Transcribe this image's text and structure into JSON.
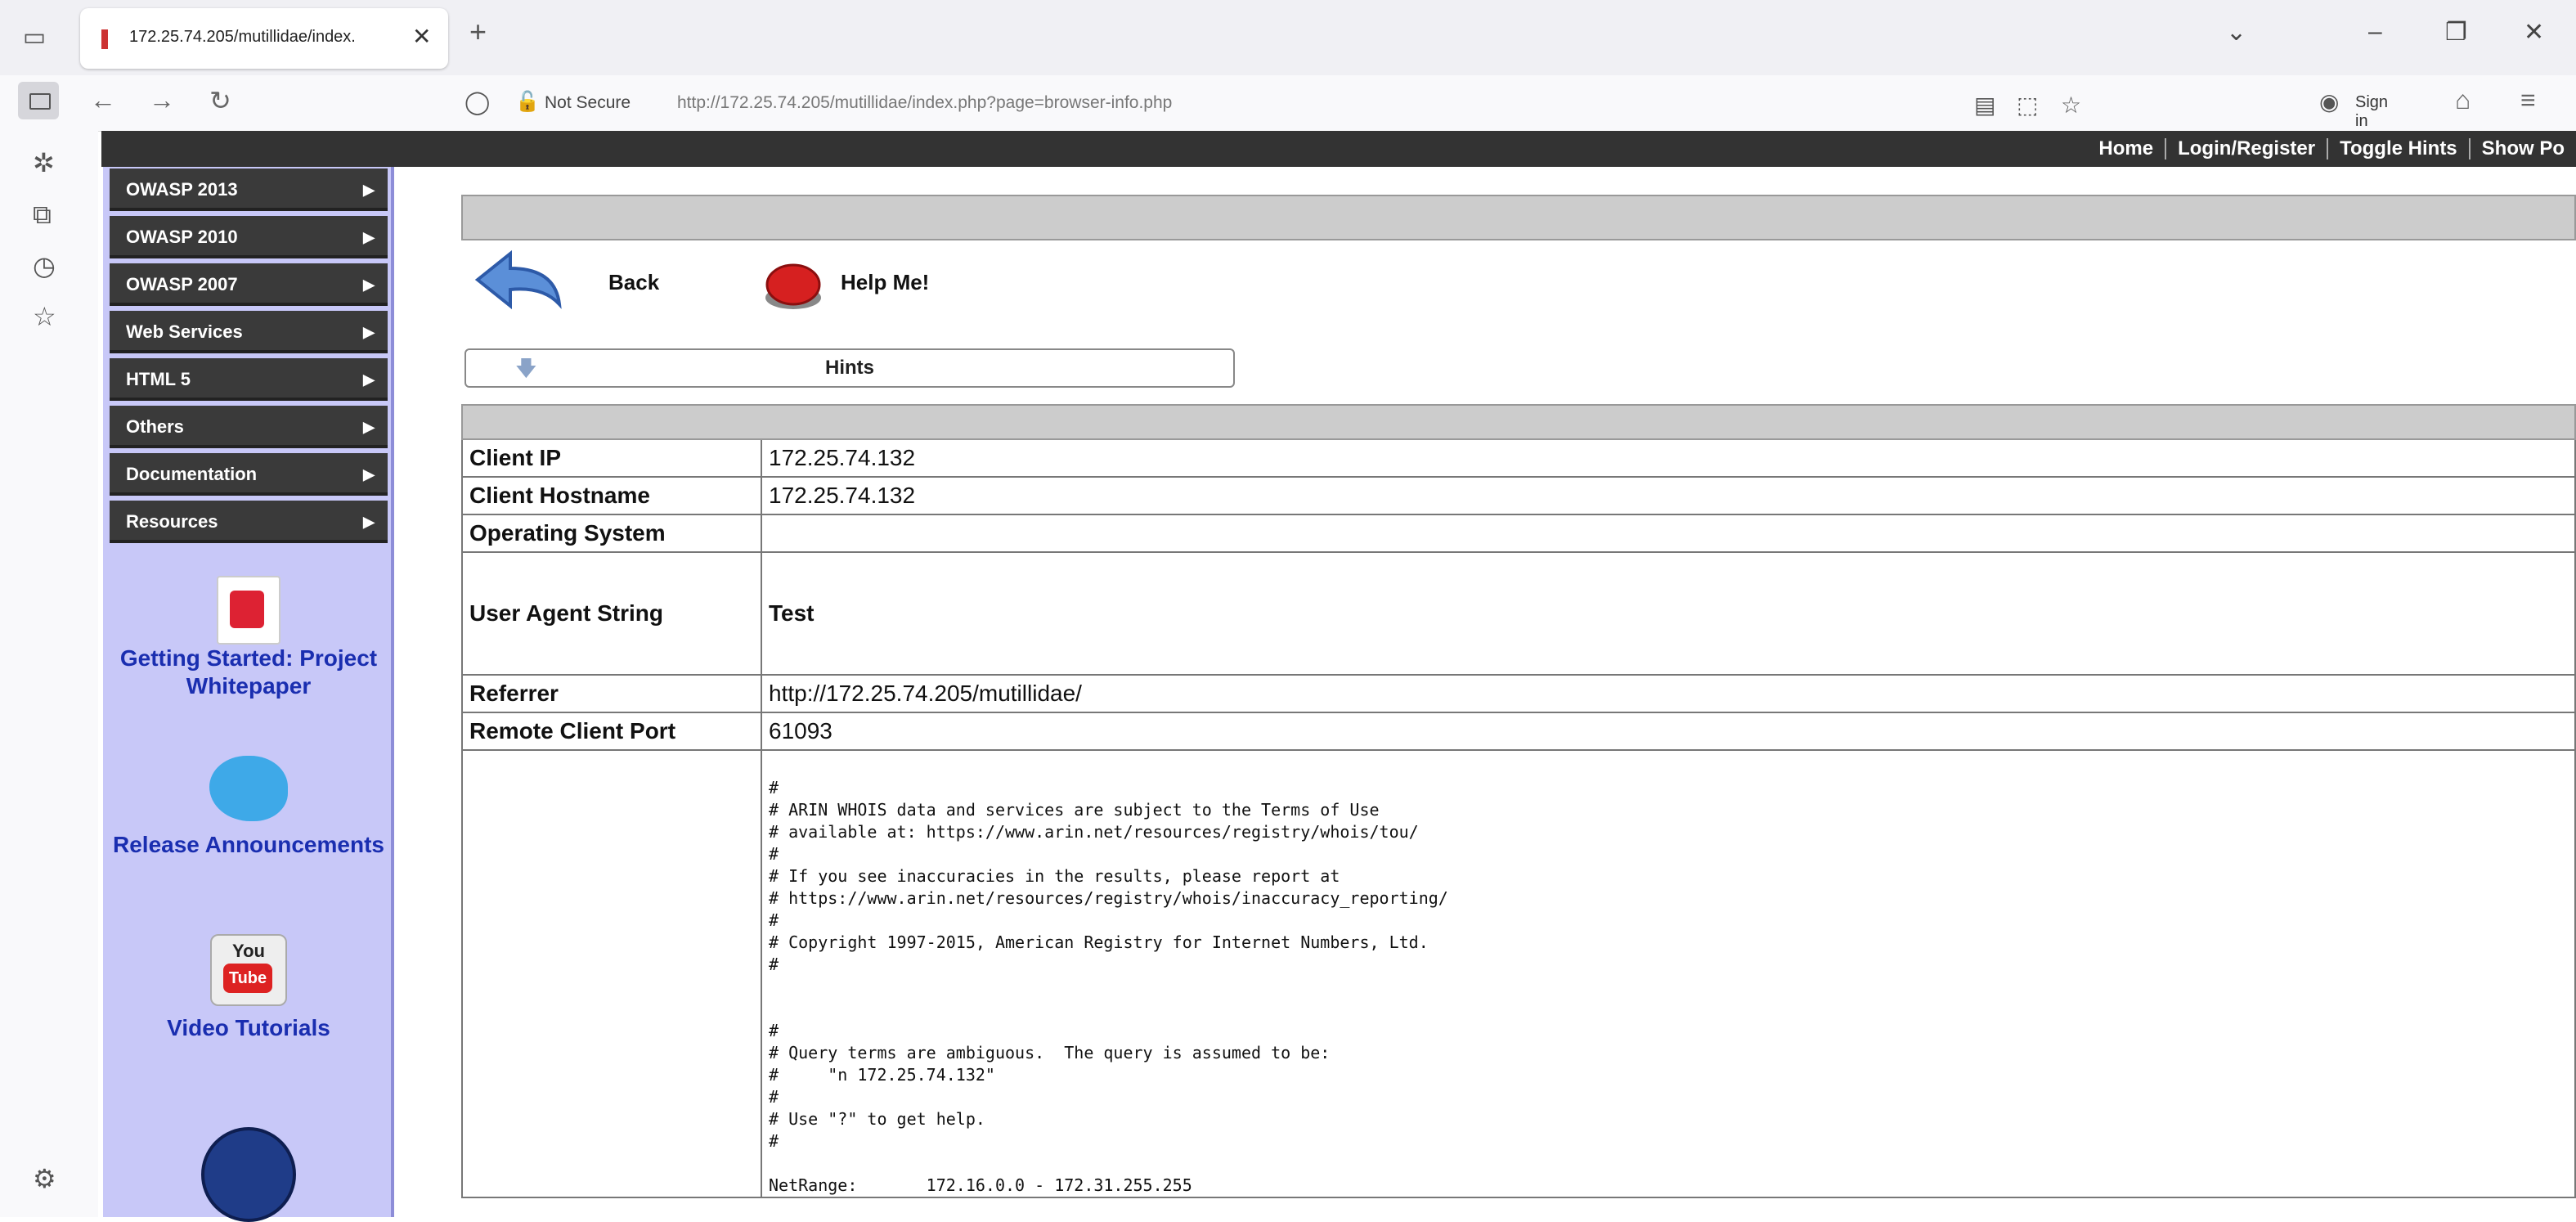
{
  "browser": {
    "tab_title": "172.25.74.205/mutillidae/index.",
    "tab_close": "✕",
    "new_tab": "+",
    "not_secure_label": "Not Secure",
    "url": "http://172.25.74.205/mutillidae/index.php?page=browser-info.php",
    "sign_in_label": "Sign in"
  },
  "topbar": {
    "links": [
      "Home",
      "Login/Register",
      "Toggle Hints",
      "Show Po"
    ]
  },
  "menu": {
    "items": [
      {
        "label": "OWASP 2013"
      },
      {
        "label": "OWASP 2010"
      },
      {
        "label": "OWASP 2007"
      },
      {
        "label": "Web Services"
      },
      {
        "label": "HTML 5"
      },
      {
        "label": "Others"
      },
      {
        "label": "Documentation"
      },
      {
        "label": "Resources"
      }
    ]
  },
  "promos": {
    "whitepaper": "Getting Started: Project Whitepaper",
    "release": "Release Announcements",
    "video": "Video Tutorials",
    "yt_top": "You",
    "yt_bottom": "Tube"
  },
  "actions": {
    "back_label": "Back",
    "help_label": "Help Me!",
    "hints_label": "Hints"
  },
  "info": {
    "rows": [
      {
        "key": "Client IP",
        "value": "172.25.74.132"
      },
      {
        "key": "Client Hostname",
        "value": "172.25.74.132"
      },
      {
        "key": "Operating System",
        "value": ""
      },
      {
        "key": "User Agent String",
        "value": "Test"
      },
      {
        "key": "Referrer",
        "value": "http://172.25.74.205/mutillidae/"
      },
      {
        "key": "Remote Client Port",
        "value": "61093"
      }
    ],
    "whois_text": "#\n# ARIN WHOIS data and services are subject to the Terms of Use\n# available at: https://www.arin.net/resources/registry/whois/tou/\n#\n# If you see inaccuracies in the results, please report at\n# https://www.arin.net/resources/registry/whois/inaccuracy_reporting/\n#\n# Copyright 1997-2015, American Registry for Internet Numbers, Ltd.\n#\n\n\n#\n# Query terms are ambiguous.  The query is assumed to be:\n#     \"n 172.25.74.132\"\n#\n# Use \"?\" to get help.\n#\n\nNetRange:       172.16.0.0 - 172.31.255.255"
  },
  "colors": {
    "menu_bg": "#3a3a3a",
    "panel_bg": "#c8c8f8",
    "topbar_bg": "#333333",
    "link_blue": "#1a2eb0"
  }
}
